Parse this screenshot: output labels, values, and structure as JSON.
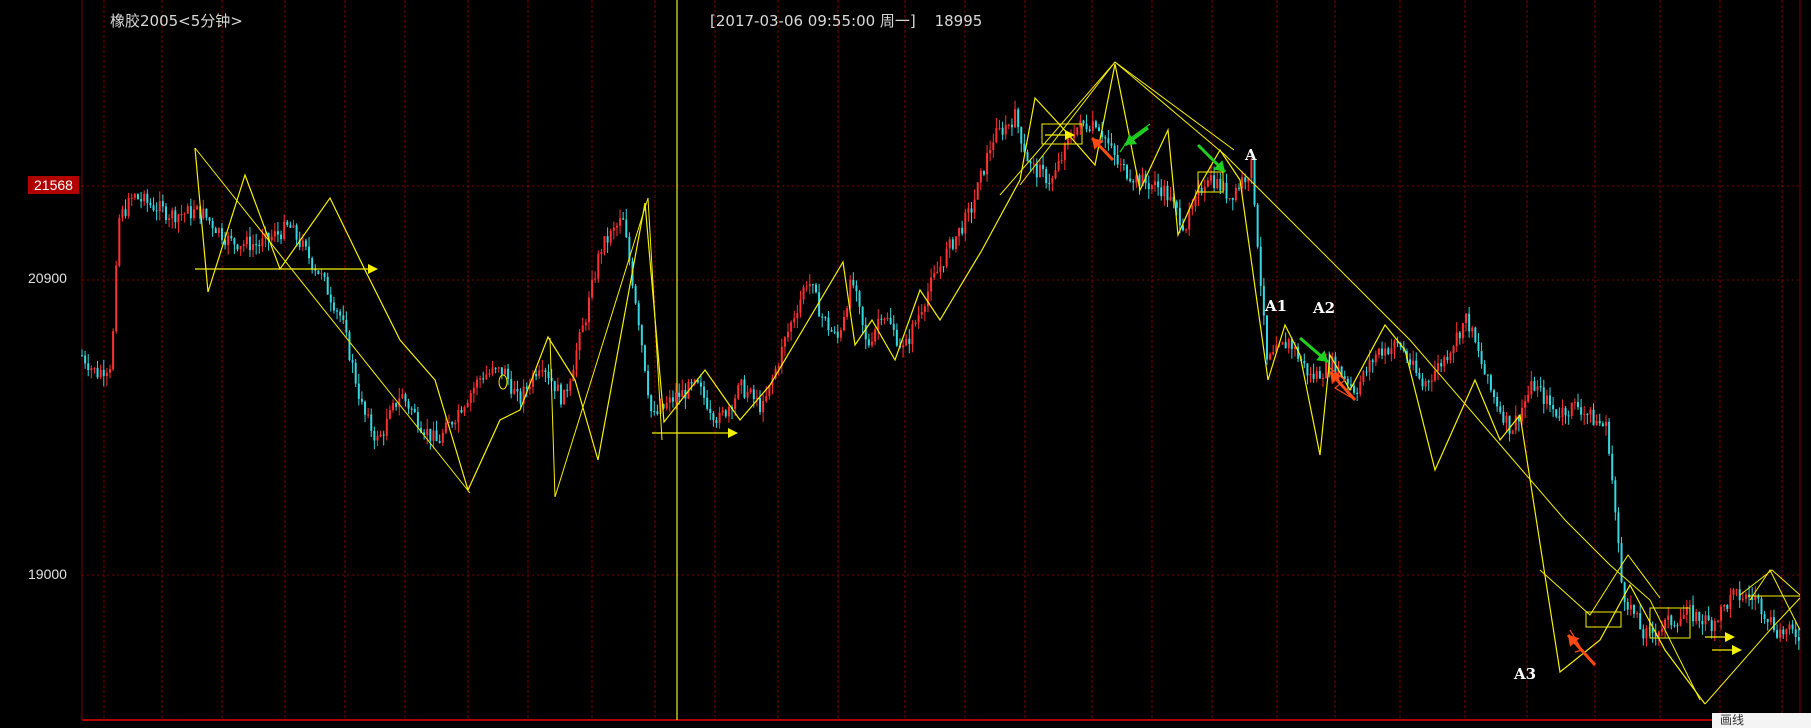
{
  "header": {
    "title": "橡胶2005<5分钟>",
    "cursor_datetime": "[2017-03-06  09:55:00 周一]",
    "cursor_price": "18995"
  },
  "y_axis": {
    "highlight_tick": "21568",
    "ticks": [
      "20900",
      "19000"
    ]
  },
  "annotations": [
    "A",
    "A1",
    "A2",
    "A3"
  ],
  "corner_tab": "画线",
  "colors": {
    "background": "#000000",
    "grid": "#7a0000",
    "zigzag": "#f5f000",
    "candle_up": "#ff3030",
    "candle_down": "#35d7e0",
    "arrow_green": "#20d020",
    "arrow_red": "#ff4a14",
    "price_tag": "#b00000"
  },
  "chart_data": {
    "type": "candlestick",
    "title": "橡胶2005<5分钟>",
    "ylim": [
      18060,
      22330
    ],
    "y_ticks": [
      21568,
      20900,
      19000
    ],
    "grid": true,
    "close_path": [
      [
        0,
        20450
      ],
      [
        2,
        20330
      ],
      [
        4,
        20400
      ],
      [
        5,
        21350
      ],
      [
        7,
        21500
      ],
      [
        12,
        21380
      ],
      [
        16,
        21400
      ],
      [
        20,
        21200
      ],
      [
        24,
        21180
      ],
      [
        28,
        21300
      ],
      [
        32,
        21000
      ],
      [
        35,
        20700
      ],
      [
        38,
        20070
      ],
      [
        40,
        19880
      ],
      [
        43,
        20200
      ],
      [
        46,
        19980
      ],
      [
        48,
        19870
      ],
      [
        51,
        20100
      ],
      [
        54,
        20320
      ],
      [
        57,
        20350
      ],
      [
        59,
        20140
      ],
      [
        62,
        20420
      ],
      [
        65,
        20150
      ],
      [
        68,
        20700
      ],
      [
        70,
        21150
      ],
      [
        73,
        21350
      ],
      [
        75,
        20750
      ],
      [
        77,
        20030
      ],
      [
        80,
        20170
      ],
      [
        83,
        20250
      ],
      [
        86,
        20020
      ],
      [
        89,
        20240
      ],
      [
        92,
        20100
      ],
      [
        95,
        20560
      ],
      [
        98,
        20960
      ],
      [
        100,
        20700
      ],
      [
        102,
        20550
      ],
      [
        104,
        20950
      ],
      [
        106,
        20500
      ],
      [
        108,
        20750
      ],
      [
        111,
        20480
      ],
      [
        114,
        20850
      ],
      [
        117,
        21150
      ],
      [
        120,
        21400
      ],
      [
        123,
        21880
      ],
      [
        126,
        22030
      ],
      [
        128,
        21700
      ],
      [
        131,
        21600
      ],
      [
        134,
        21950
      ],
      [
        137,
        22000
      ],
      [
        140,
        21700
      ],
      [
        143,
        21600
      ],
      [
        146,
        21550
      ],
      [
        149,
        21300
      ],
      [
        152,
        21650
      ],
      [
        155,
        21500
      ],
      [
        158,
        21700
      ],
      [
        160,
        20400
      ],
      [
        163,
        20550
      ],
      [
        166,
        20300
      ],
      [
        169,
        20400
      ],
      [
        172,
        20220
      ],
      [
        175,
        20480
      ],
      [
        178,
        20520
      ],
      [
        181,
        20250
      ],
      [
        184,
        20430
      ],
      [
        187,
        20700
      ],
      [
        190,
        20240
      ],
      [
        193,
        19960
      ],
      [
        196,
        20260
      ],
      [
        199,
        20070
      ],
      [
        202,
        20120
      ],
      [
        204,
        20030
      ],
      [
        206,
        19970
      ],
      [
        208,
        18900
      ],
      [
        211,
        18590
      ],
      [
        214,
        18680
      ],
      [
        217,
        18750
      ],
      [
        220,
        18680
      ],
      [
        223,
        18860
      ],
      [
        226,
        18850
      ],
      [
        229,
        18630
      ],
      [
        232,
        18610
      ]
    ],
    "annotations": [
      {
        "label": "A",
        "x": 158,
        "y": 21700
      },
      {
        "label": "A1",
        "x": 163,
        "y": 20650
      },
      {
        "label": "A2",
        "x": 170,
        "y": 20620
      },
      {
        "label": "A3",
        "x": 207,
        "y": 18400
      }
    ]
  }
}
